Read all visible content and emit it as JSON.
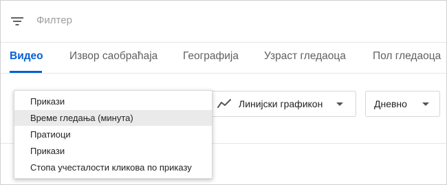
{
  "filter": {
    "icon": "filter-icon",
    "placeholder": "Филтер"
  },
  "tabs": [
    {
      "label": "Видео",
      "active": true
    },
    {
      "label": "Извор саобраћаја",
      "active": false
    },
    {
      "label": "Географија",
      "active": false
    },
    {
      "label": "Узраст гледаоца",
      "active": false
    },
    {
      "label": "Пол гледаоца",
      "active": false
    }
  ],
  "controls": {
    "chart_type": {
      "icon": "line-chart-icon",
      "label": "Линијски графикон"
    },
    "period": {
      "label": "Дневно"
    }
  },
  "metric_menu": {
    "items": [
      {
        "label": "Прикази",
        "selected": false
      },
      {
        "label": "Време гледања (минута)",
        "selected": true
      },
      {
        "label": "Пратиоци",
        "selected": false
      },
      {
        "label": "Прикази",
        "selected": false
      },
      {
        "label": "Стопа учесталости кликова по приказу",
        "selected": false
      }
    ]
  },
  "colors": {
    "accent": "#065fd4",
    "tab_inactive": "#606060",
    "placeholder": "#9e9e9e",
    "selected_item_bg": "#eaeaea"
  }
}
